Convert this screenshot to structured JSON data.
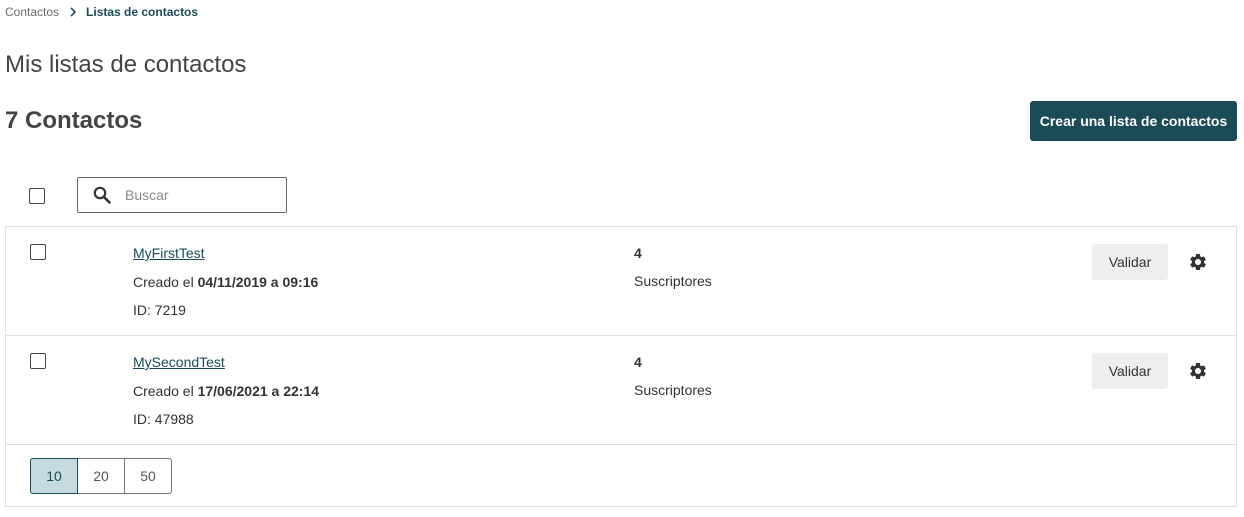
{
  "breadcrumb": {
    "root": "Contactos",
    "current": "Listas de contactos"
  },
  "page_title": "Mis listas de contactos",
  "count_title": "7 Contactos",
  "create_button": "Crear una lista de contactos",
  "search": {
    "placeholder": "Buscar",
    "value": ""
  },
  "lists": [
    {
      "name": "MyFirstTest",
      "created_prefix": "Creado el ",
      "created_value": "04/11/2019 a 09:16",
      "id_text": "ID: 7219",
      "subscribers": "4",
      "subscribers_label": "Suscriptores",
      "validate_label": "Validar"
    },
    {
      "name": "MySecondTest",
      "created_prefix": "Creado el ",
      "created_value": "17/06/2021 a 22:14",
      "id_text": "ID: 47988",
      "subscribers": "4",
      "subscribers_label": "Suscriptores",
      "validate_label": "Validar"
    }
  ],
  "pagination": {
    "options": [
      "10",
      "20",
      "50"
    ],
    "selected": "10"
  },
  "colors": {
    "brand": "#1a4b57",
    "active_page_bg": "#c6dbe0",
    "validate_bg": "#eeeeee"
  },
  "icons": {
    "breadcrumb_separator": "chevron-right-icon",
    "search": "search-icon",
    "row_settings": "gear-icon"
  }
}
